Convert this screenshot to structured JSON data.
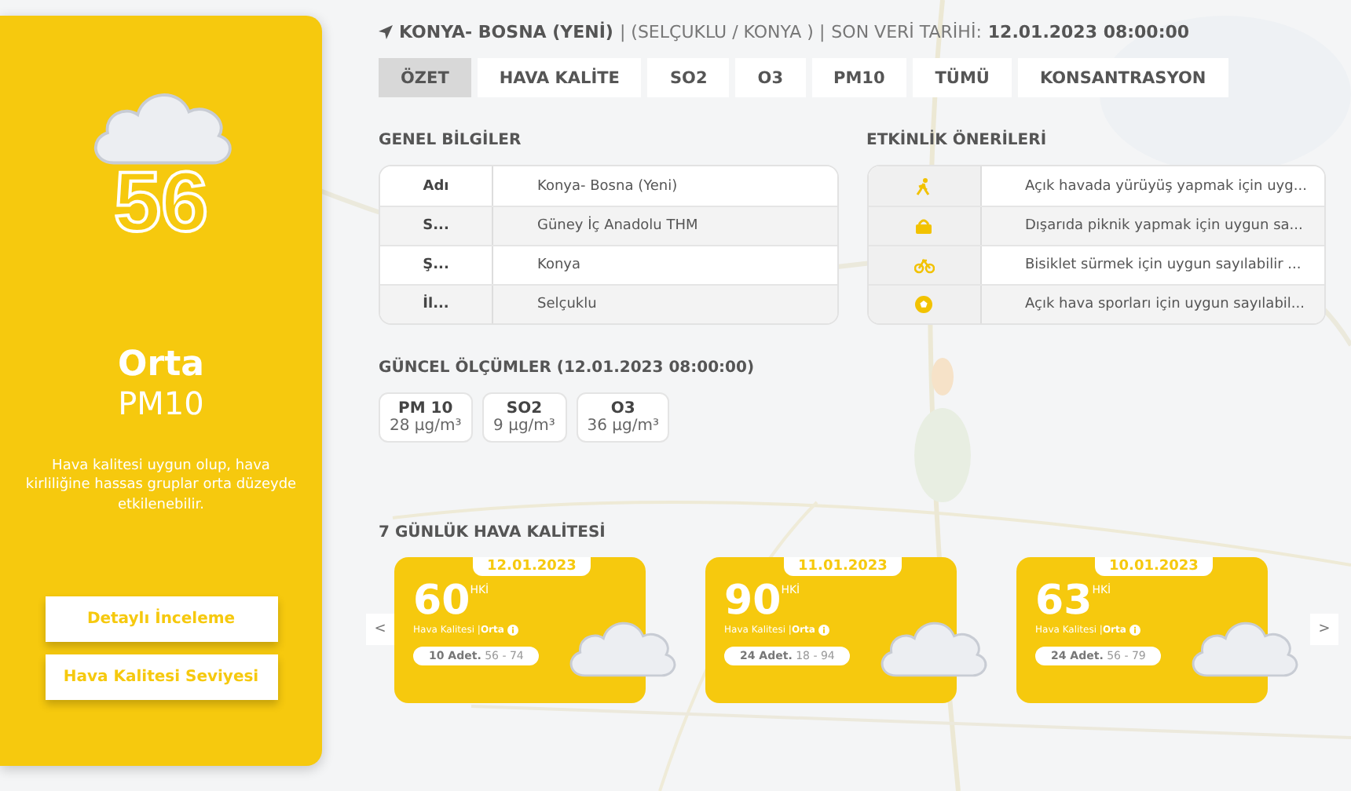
{
  "station": {
    "index": "56",
    "level": "Orta",
    "pollutant": "PM10",
    "description": "Hava kalitesi uygun olup, hava kirliliğine hassas gruplar orta düzeyde etkilenebilir.",
    "buttons": [
      "Detaylı İnceleme",
      "Hava Kalitesi Seviyesi"
    ]
  },
  "header": {
    "name": "KONYA- BOSNA (YENİ)",
    "region": "| (SELÇUKLU / KONYA ) |",
    "date_label": "SON VERİ TARİHİ:",
    "date": "12.01.2023 08:00:00"
  },
  "tabs": [
    {
      "label": "ÖZET",
      "selected": true
    },
    {
      "label": "HAVA KALİTE",
      "selected": false
    },
    {
      "label": "SO2",
      "selected": false
    },
    {
      "label": "O3",
      "selected": false
    },
    {
      "label": "PM10",
      "selected": false
    },
    {
      "label": "TÜMÜ",
      "selected": false
    },
    {
      "label": "KONSANTRASYON",
      "selected": false
    }
  ],
  "general": {
    "title": "GENEL BİLGİLER",
    "rows": [
      {
        "key": "Adı",
        "value": "Konya- Bosna (Yeni)"
      },
      {
        "key": "S...",
        "value": "Güney İç Anadolu THM"
      },
      {
        "key": "Ş...",
        "value": "Konya"
      },
      {
        "key": "İl...",
        "value": "Selçuklu"
      }
    ]
  },
  "activities": {
    "title": "ETKİNLİK ÖNERİLERİ",
    "rows": [
      {
        "kind": "walk",
        "text": "Açık havada yürüyüş yapmak için uyg..."
      },
      {
        "kind": "picnic",
        "text": "Dışarıda piknik yapmak için uygun sa..."
      },
      {
        "kind": "bike",
        "text": "Bisiklet sürmek için uygun sayılabilir ..."
      },
      {
        "kind": "ball",
        "text": "Açık hava sporları için uygun sayılabil..."
      }
    ]
  },
  "measurements": {
    "title": "GÜNCEL ÖLÇÜMLER (12.01.2023 08:00:00)",
    "items": [
      {
        "name": "PM 10",
        "value": "28 µg/m³"
      },
      {
        "name": "SO2",
        "value": "9 µg/m³"
      },
      {
        "name": "O3",
        "value": "36 µg/m³"
      }
    ]
  },
  "forecast": {
    "title": "7 GÜNLÜK HAVA KALİTESİ",
    "prev": "<",
    "next": ">",
    "days": [
      {
        "date": "12.01.2023",
        "value": "60",
        "unit": "HKİ",
        "quality": "Hava Kalitesi |**Orta**",
        "range": "**10 Adet.** 56 - 74"
      },
      {
        "date": "11.01.2023",
        "value": "90",
        "unit": "HKİ",
        "quality": "Hava Kalitesi |**Orta**",
        "range": "**24 Adet.** 18 - 94"
      },
      {
        "date": "10.01.2023",
        "value": "63",
        "unit": "HKİ",
        "quality": "Hava Kalitesi |**Orta**",
        "range": "**24 Adet.** 56 - 79"
      }
    ]
  }
}
